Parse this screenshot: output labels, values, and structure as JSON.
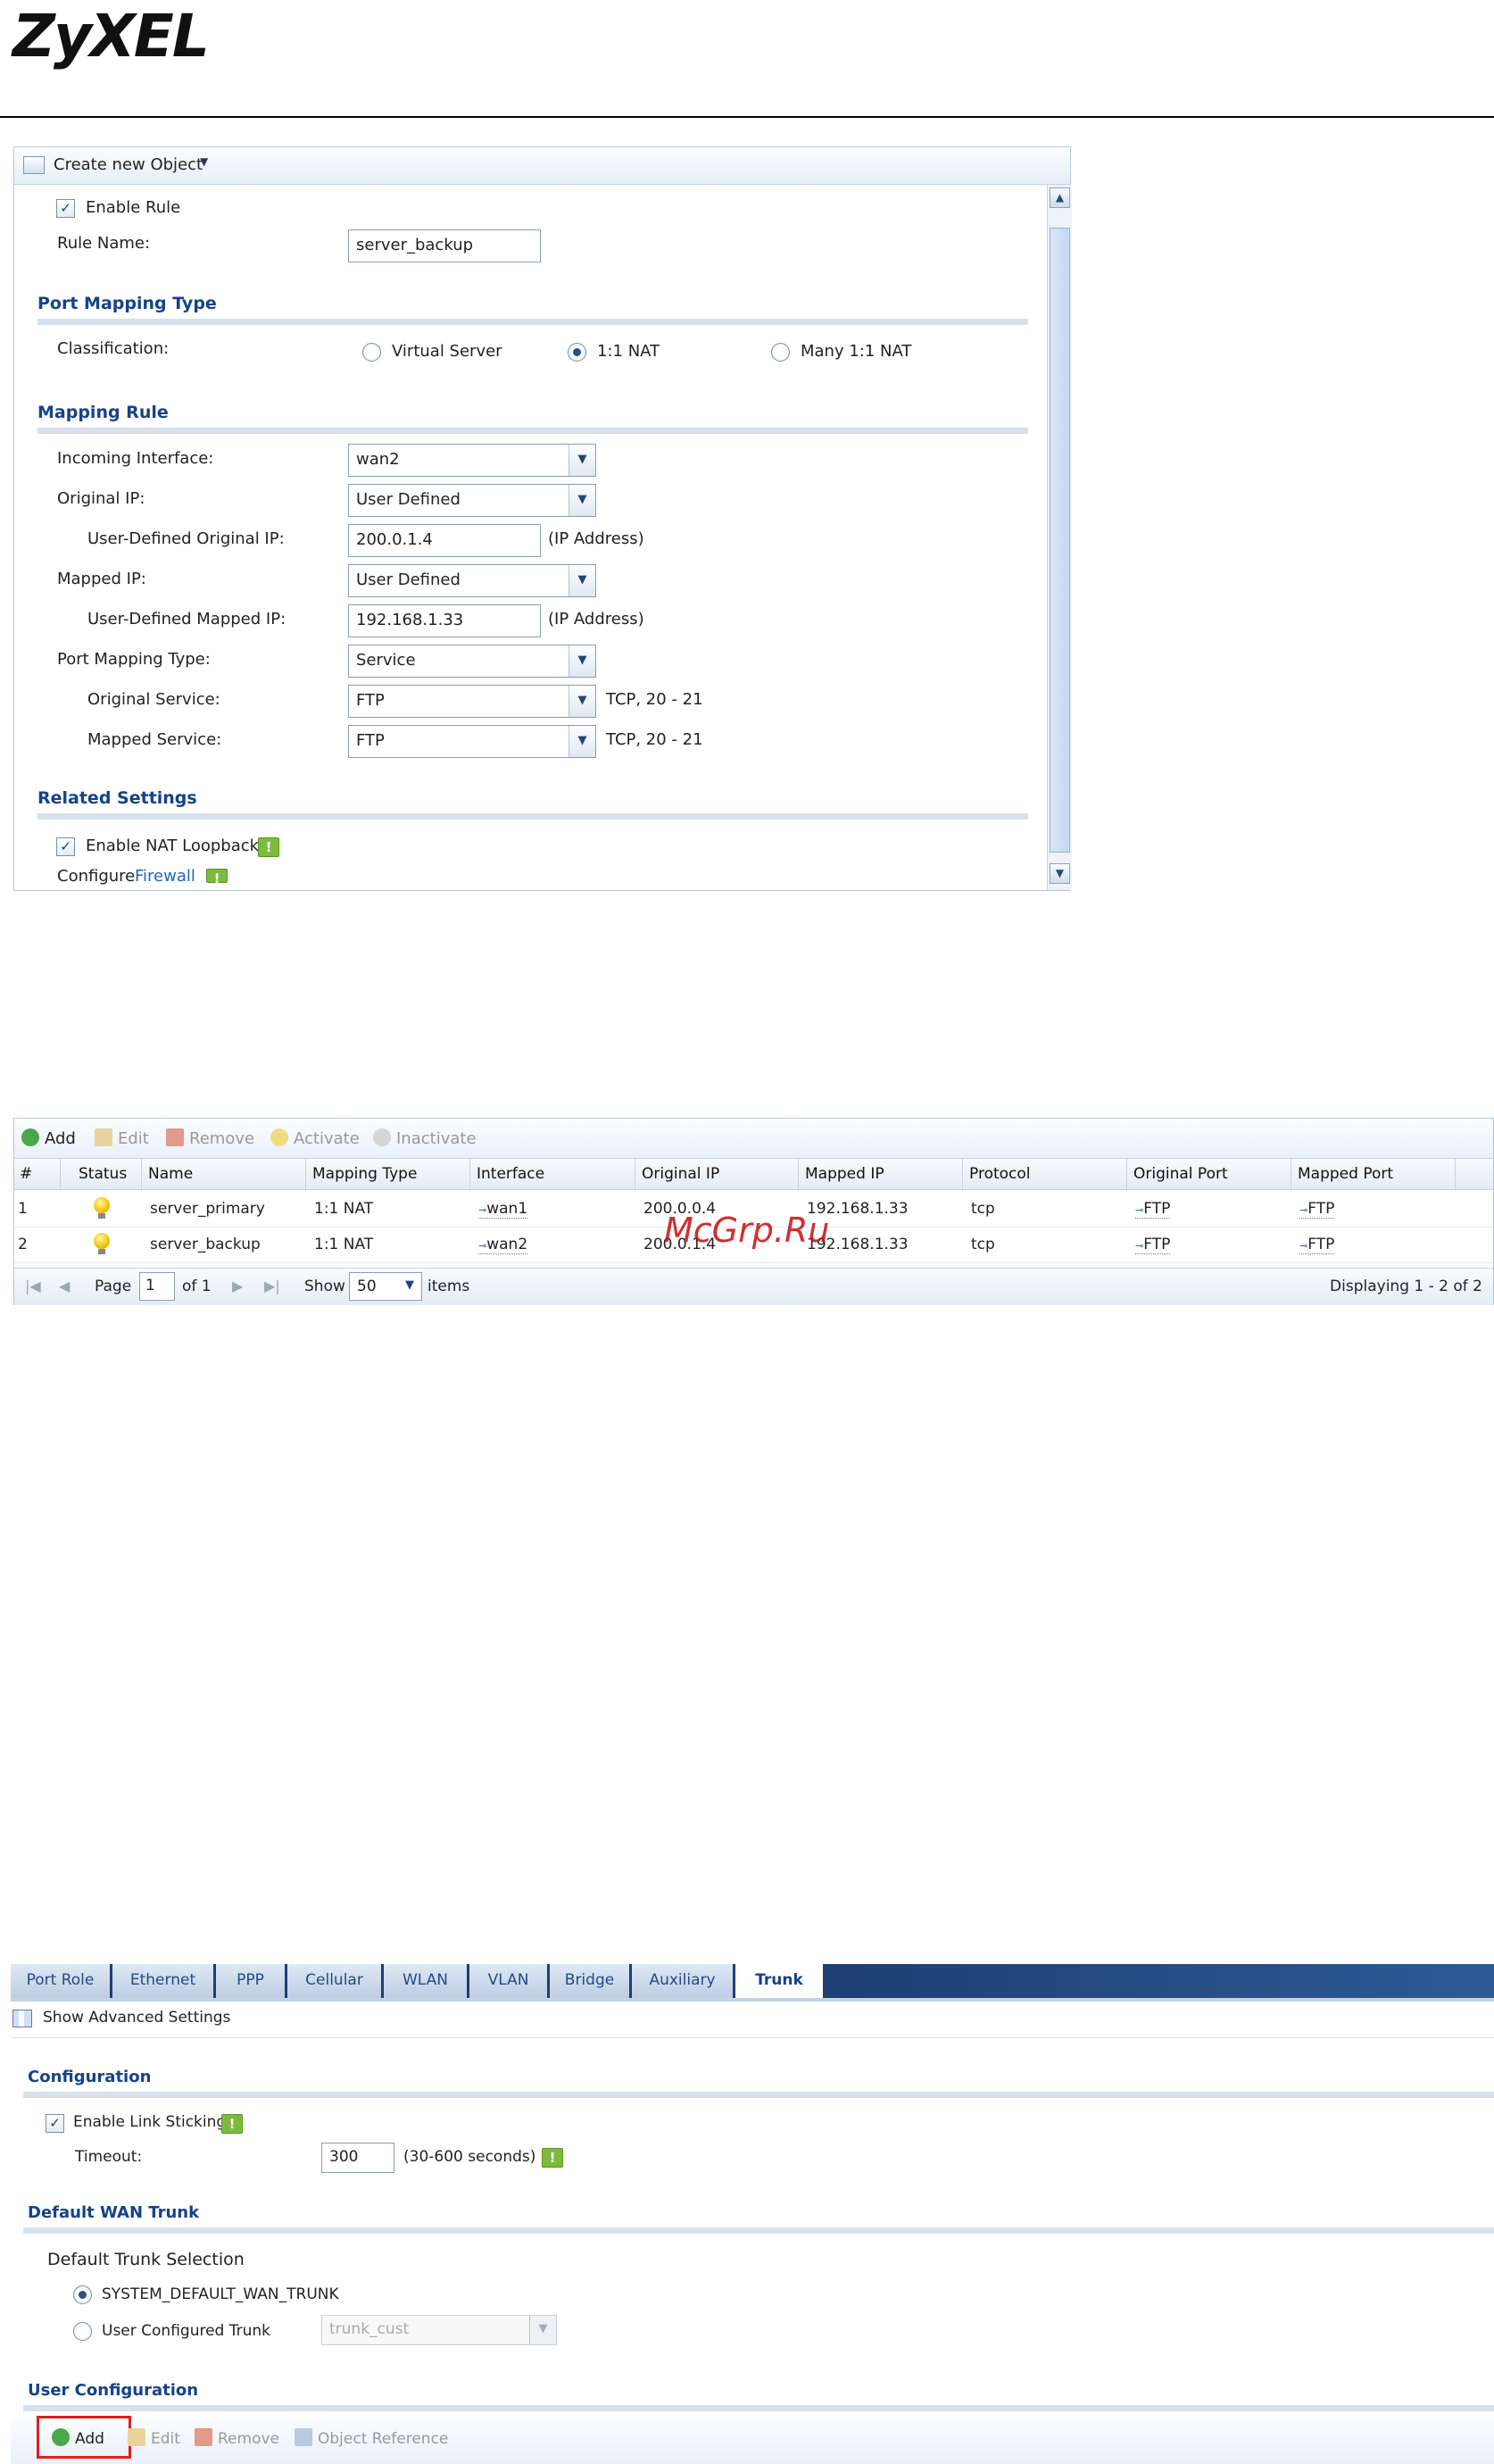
{
  "logo": "ZyXEL",
  "nat_form": {
    "toolbar": {
      "create_label": "Create new Object",
      "dropdown_icon": "chevron-down-icon"
    },
    "enable_rule_label": "Enable Rule",
    "enable_rule_checked": true,
    "rule_name_label": "Rule Name:",
    "rule_name_value": "server_backup",
    "port_mapping_section": "Port Mapping Type",
    "classification_label": "Classification:",
    "classification_options": [
      "Virtual Server",
      "1:1 NAT",
      "Many 1:1 NAT"
    ],
    "classification_selected": "1:1 NAT",
    "mapping_section": "Mapping Rule",
    "incoming_interface_label": "Incoming Interface:",
    "incoming_interface_value": "wan2",
    "original_ip_label": "Original IP:",
    "original_ip_value": "User Defined",
    "user_original_ip_label": "User-Defined Original IP:",
    "user_original_ip_value": "200.0.1.4",
    "ip_address_hint": "(IP Address)",
    "mapped_ip_label": "Mapped IP:",
    "mapped_ip_value": "User Defined",
    "user_mapped_ip_label": "User-Defined Mapped IP:",
    "user_mapped_ip_value": "192.168.1.33",
    "port_mapping_type_label": "Port Mapping Type:",
    "port_mapping_type_value": "Service",
    "original_service_label": "Original Service:",
    "original_service_value": "FTP",
    "original_service_hint": "TCP, 20 - 21",
    "mapped_service_label": "Mapped Service:",
    "mapped_service_value": "FTP",
    "mapped_service_hint": "TCP, 20 - 21",
    "related_section": "Related Settings",
    "nat_loopback_label": "Enable NAT Loopback",
    "configure_label": "Configure",
    "firewall_link": "Firewall"
  },
  "nat_list": {
    "toolbar": [
      "Add",
      "Edit",
      "Remove",
      "Activate",
      "Inactivate"
    ],
    "columns": [
      "#",
      "Status",
      "Name",
      "Mapping Type",
      "Interface",
      "Original IP",
      "Mapped IP",
      "Protocol",
      "Original Port",
      "Mapped Port"
    ],
    "rows": [
      {
        "num": "1",
        "name": "server_primary",
        "type": "1:1 NAT",
        "iface": "wan1",
        "orig_ip": "200.0.0.4",
        "mapped_ip": "192.168.1.33",
        "proto": "tcp",
        "orig_port": "FTP",
        "mapped_port": "FTP"
      },
      {
        "num": "2",
        "name": "server_backup",
        "type": "1:1 NAT",
        "iface": "wan2",
        "orig_ip": "200.0.1.4",
        "mapped_ip": "192.168.1.33",
        "proto": "tcp",
        "orig_port": "FTP",
        "mapped_port": "FTP"
      }
    ],
    "pager": {
      "page_label": "Page",
      "page_value": "1",
      "of_label": "of 1",
      "show_label": "Show",
      "show_value": "50",
      "items_label": "items",
      "display_text": "Displaying 1 - 2 of 2"
    }
  },
  "watermark": "McGrp.Ru",
  "trunk": {
    "tabs": [
      "Port Role",
      "Ethernet",
      "PPP",
      "Cellular",
      "WLAN",
      "VLAN",
      "Bridge",
      "Auxiliary",
      "Trunk"
    ],
    "active_tab": "Trunk",
    "show_advanced": "Show Advanced Settings",
    "config_section": "Configuration",
    "link_sticking_label": "Enable Link Sticking",
    "timeout_label": "Timeout:",
    "timeout_value": "300",
    "timeout_hint": "(30-600 seconds)",
    "default_wan_section": "Default WAN Trunk",
    "trunk_selection_label": "Default Trunk Selection",
    "trunk_option_default": "SYSTEM_DEFAULT_WAN_TRUNK",
    "trunk_option_user": "User Configured Trunk",
    "trunk_user_value": "trunk_cust",
    "user_config_section": "User Configuration",
    "toolbar": [
      "Add",
      "Edit",
      "Remove",
      "Object Reference"
    ],
    "highlight_color": "#e02020"
  }
}
